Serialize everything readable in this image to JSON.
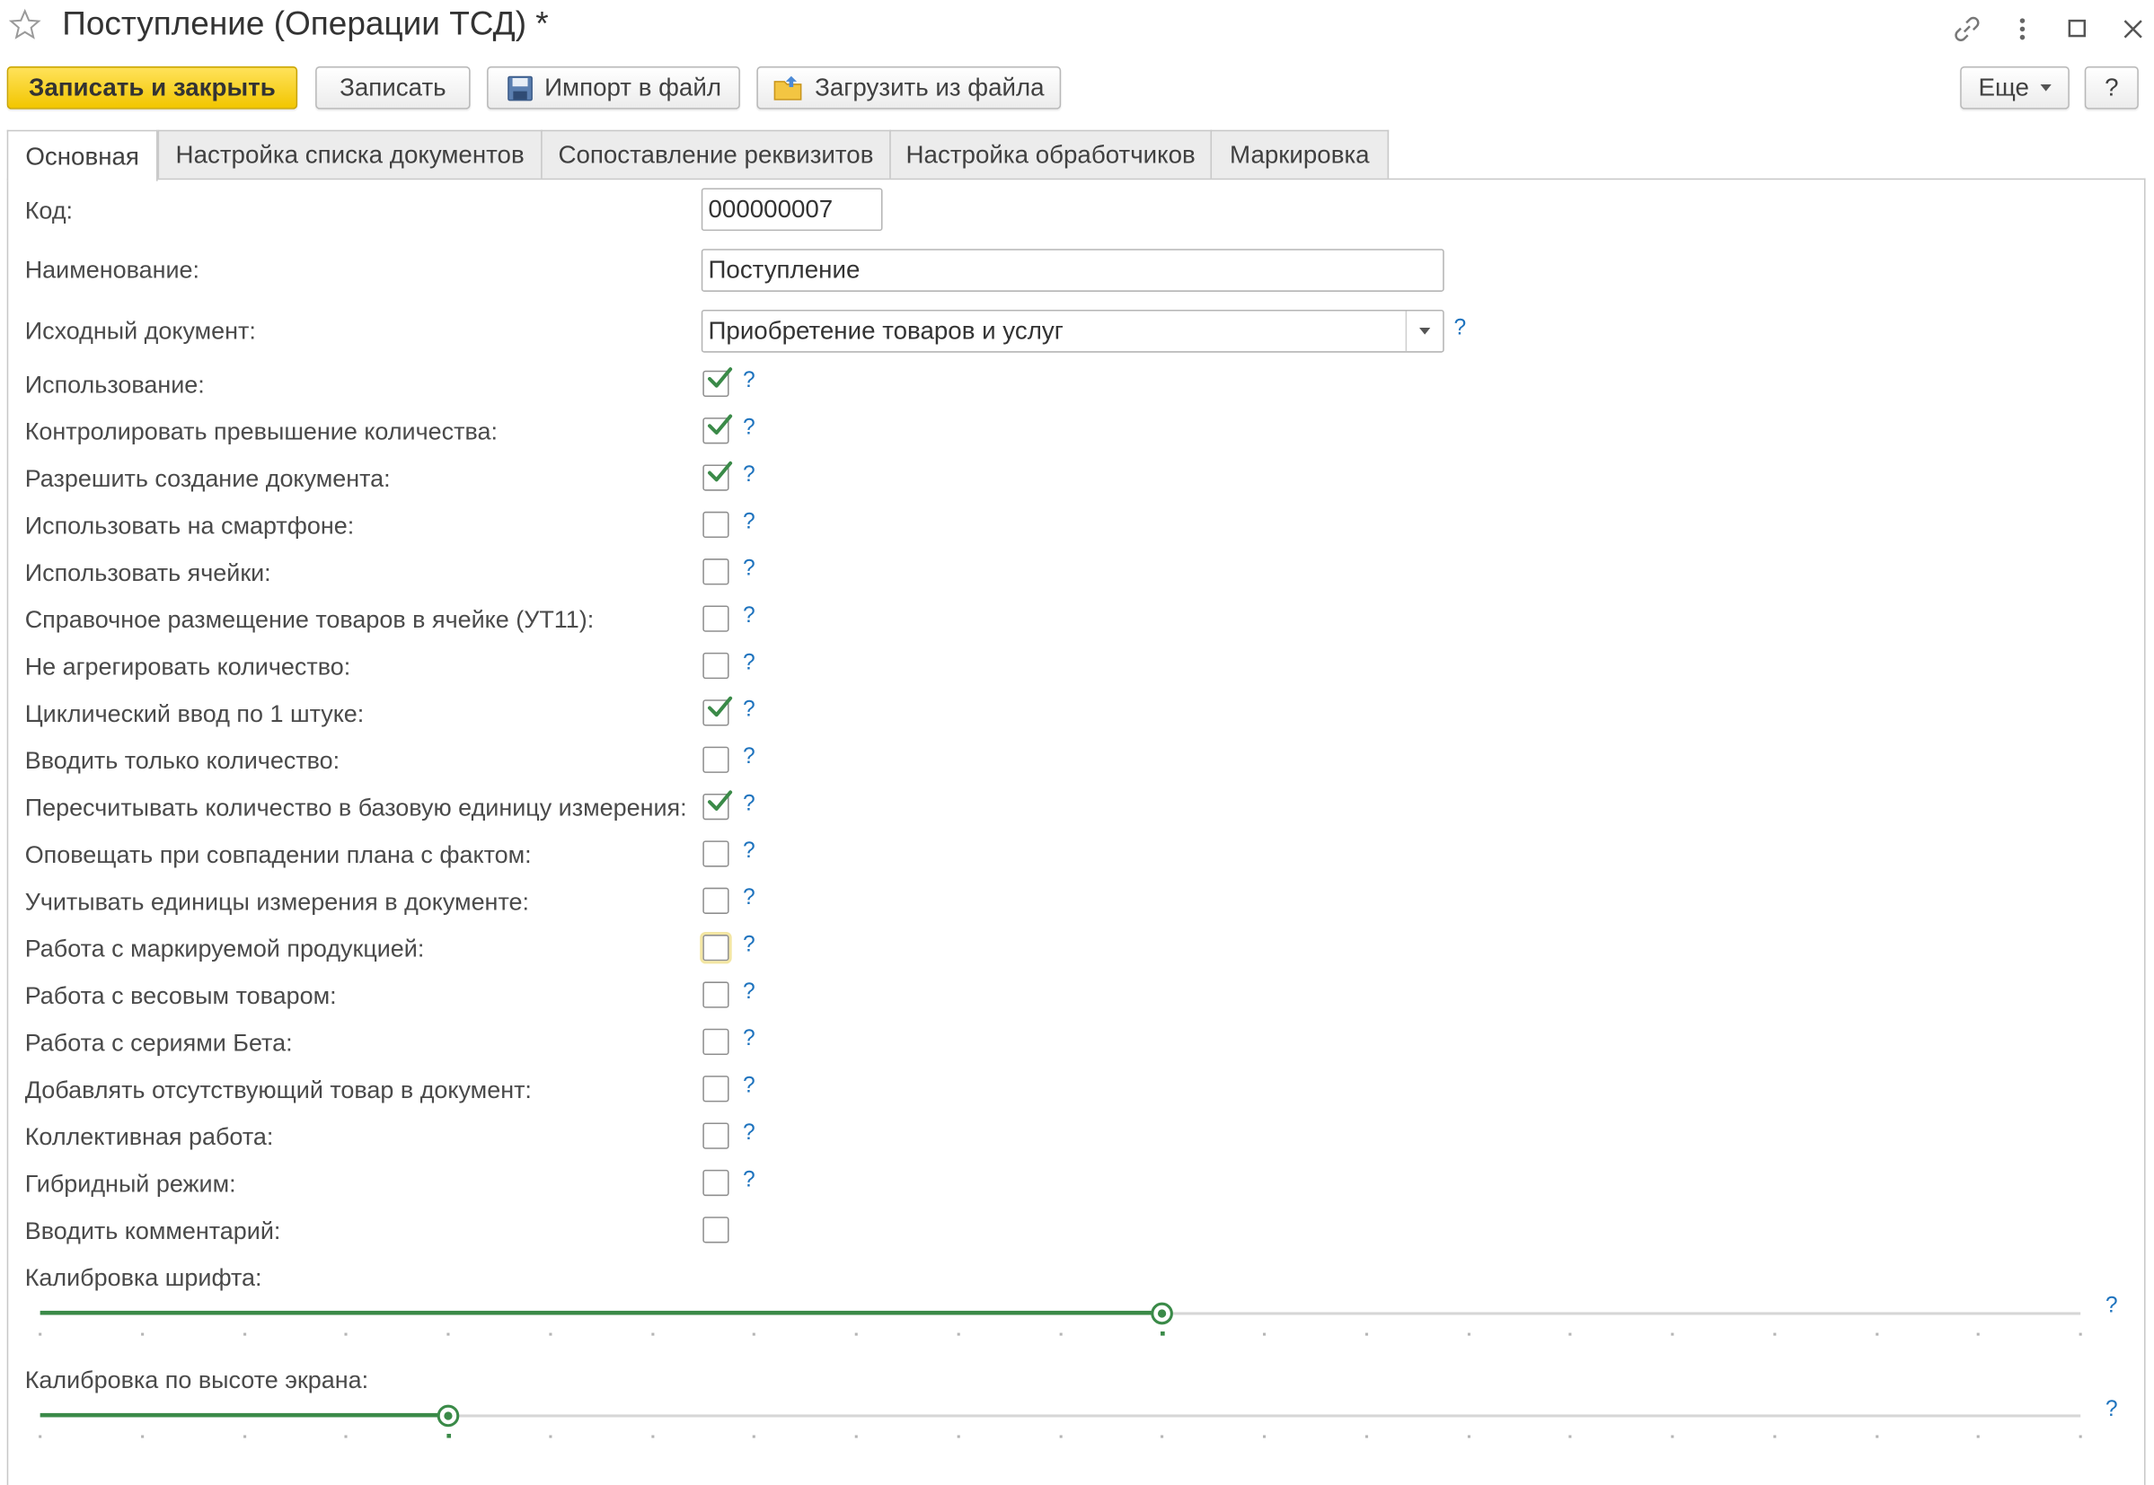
{
  "window": {
    "title": "Поступление (Операции ТСД) *",
    "icons": [
      "star-icon",
      "link-icon",
      "more-vertical-icon",
      "maximize-icon",
      "close-icon"
    ]
  },
  "toolbar": {
    "save_close": "Записать и закрыть",
    "save": "Записать",
    "import": "Импорт в файл",
    "load": "Загрузить из файла",
    "more": "Еще",
    "help": "?"
  },
  "tabs": [
    {
      "label": "Основная",
      "active": true
    },
    {
      "label": "Настройка списка документов",
      "active": false
    },
    {
      "label": "Сопоставление реквизитов",
      "active": false
    },
    {
      "label": "Настройка обработчиков",
      "active": false
    },
    {
      "label": "Маркировка",
      "active": false
    }
  ],
  "form": {
    "code": {
      "label": "Код:",
      "value": "000000007"
    },
    "name": {
      "label": "Наименование:",
      "value": "Поступление"
    },
    "source_doc": {
      "label": "Исходный документ:",
      "value": "Приобретение товаров и услуг",
      "help": "?"
    },
    "checkboxes": [
      {
        "label": "Использование:",
        "checked": true,
        "help": "?"
      },
      {
        "label": "Контролировать превышение количества:",
        "checked": true,
        "help": "?"
      },
      {
        "label": "Разрешить создание документа:",
        "checked": true,
        "help": "?"
      },
      {
        "label": "Использовать на смартфоне:",
        "checked": false,
        "help": "?"
      },
      {
        "label": "Использовать ячейки:",
        "checked": false,
        "help": "?"
      },
      {
        "label": "Справочное размещение товаров в ячейке (УТ11):",
        "checked": false,
        "help": "?"
      },
      {
        "label": "Не агрегировать количество:",
        "checked": false,
        "help": "?"
      },
      {
        "label": "Циклический ввод по 1 штуке:",
        "checked": true,
        "help": "?"
      },
      {
        "label": "Вводить только количество:",
        "checked": false,
        "help": "?"
      },
      {
        "label": "Пересчитывать количество в базовую единицу измерения:",
        "checked": true,
        "help": "?"
      },
      {
        "label": "Оповещать при совпадении плана с фактом:",
        "checked": false,
        "help": "?"
      },
      {
        "label": "Учитывать единицы измерения в документе:",
        "checked": false,
        "help": "?"
      },
      {
        "label": "Работа с маркируемой продукцией:",
        "checked": false,
        "help": "?",
        "focused": true
      },
      {
        "label": "Работа с весовым товаром:",
        "checked": false,
        "help": "?"
      },
      {
        "label": "Работа с сериями Бета:",
        "checked": false,
        "help": "?"
      },
      {
        "label": "Добавлять отсутствующий товар в документ:",
        "checked": false,
        "help": "?"
      },
      {
        "label": "Коллективная работа:",
        "checked": false,
        "help": "?"
      },
      {
        "label": "Гибридный режим:",
        "checked": false,
        "help": "?"
      },
      {
        "label": "Вводить комментарий:",
        "checked": false
      }
    ],
    "sliders": [
      {
        "label": "Калибровка шрифта:",
        "position": 0.55,
        "help": "?"
      },
      {
        "label": "Калибровка по высоте экрана:",
        "position": 0.2,
        "help": "?"
      }
    ]
  },
  "colors": {
    "accent": "#3a8a48",
    "primary_button": "#f2c600",
    "help": "#1e73be"
  }
}
